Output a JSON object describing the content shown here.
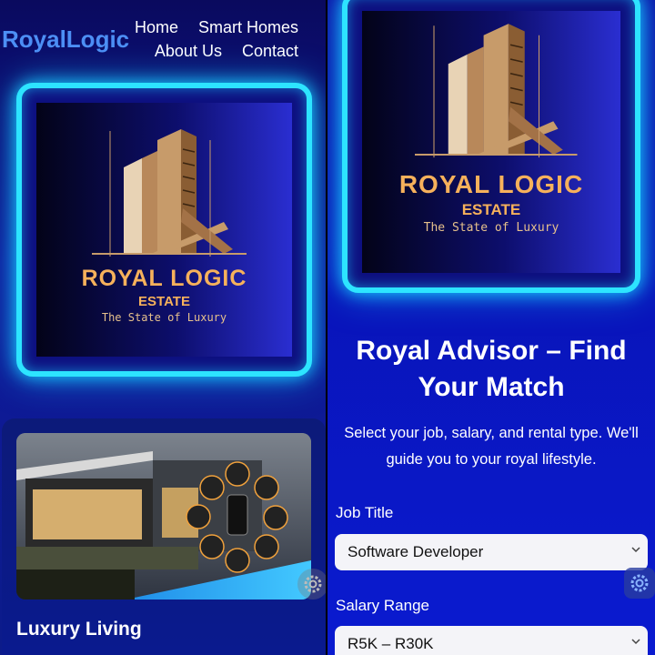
{
  "left": {
    "brand": "RoyalLogic",
    "nav": [
      "Home",
      "Smart Homes",
      "About Us",
      "Contact"
    ],
    "logo": {
      "title": "ROYAL LOGIC",
      "subtitle": "ESTATE",
      "tagline": "The State of Luxury"
    },
    "card": {
      "title": "Luxury Living"
    }
  },
  "right": {
    "logo": {
      "title": "ROYAL LOGIC",
      "subtitle": "ESTATE",
      "tagline": "The State of Luxury"
    },
    "advisor": {
      "title": "Royal Advisor – Find Your Match",
      "description": "Select your job, salary, and rental type. We'll guide you to your royal lifestyle."
    },
    "job_title": {
      "label": "Job Title",
      "value": "Software Developer"
    },
    "salary_range": {
      "label": "Salary Range",
      "value": "R5K – R30K"
    }
  },
  "icons": [
    "settings-gear-icon",
    "chevron-down-icon"
  ],
  "colors": {
    "brand": "#4d8ff5",
    "neon": "#2de4ff",
    "gold": "#f6b15b"
  }
}
